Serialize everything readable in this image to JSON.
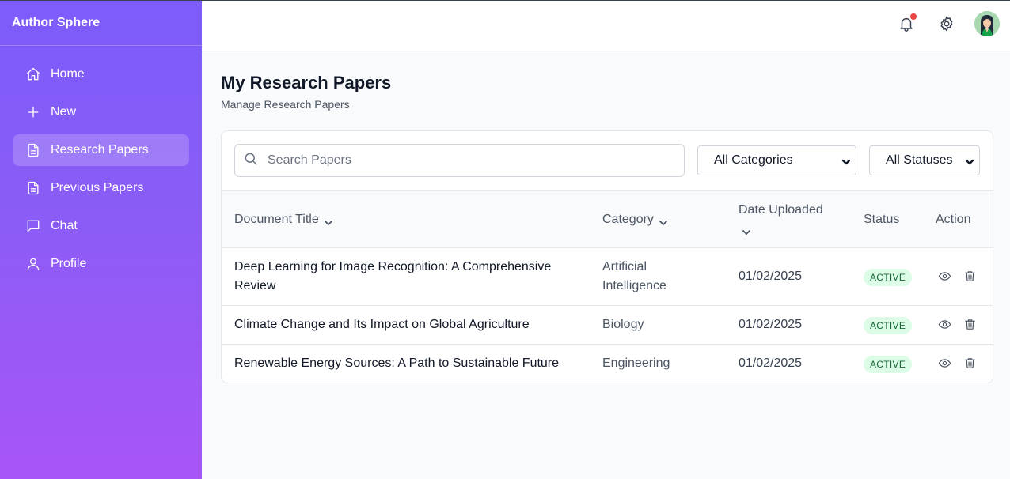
{
  "app": {
    "name": "Author Sphere"
  },
  "sidebar": {
    "items": [
      {
        "label": "Home",
        "icon": "home-icon",
        "active": false
      },
      {
        "label": "New",
        "icon": "plus-icon",
        "active": false
      },
      {
        "label": "Research Papers",
        "icon": "document-icon",
        "active": true
      },
      {
        "label": "Previous Papers",
        "icon": "document-icon",
        "active": false
      },
      {
        "label": "Chat",
        "icon": "chat-icon",
        "active": false
      },
      {
        "label": "Profile",
        "icon": "user-icon",
        "active": false
      }
    ]
  },
  "topbar": {
    "icons": [
      "bell-icon",
      "gear-icon",
      "avatar"
    ]
  },
  "page": {
    "title": "My Research Papers",
    "subtitle": "Manage Research Papers"
  },
  "filters": {
    "search_placeholder": "Search Papers",
    "category_selected": "All Categories",
    "status_selected": "All Statuses"
  },
  "table": {
    "headers": {
      "title": "Document Title",
      "category": "Category",
      "date": "Date Uploaded",
      "status": "Status",
      "action": "Action"
    },
    "rows": [
      {
        "title": "Deep Learning for Image Recognition: A Comprehensive Review",
        "category": "Artificial Intelligence",
        "date": "01/02/2025",
        "status": "ACTIVE"
      },
      {
        "title": "Climate Change and Its Impact on Global Agriculture",
        "category": "Biology",
        "date": "01/02/2025",
        "status": "ACTIVE"
      },
      {
        "title": "Renewable Energy Sources: A Path to Sustainable Future",
        "category": "Engineering",
        "date": "01/02/2025",
        "status": "ACTIVE"
      }
    ]
  },
  "colors": {
    "sidebar_top": "#7c5cfb",
    "sidebar_bottom": "#a855f7",
    "badge_bg": "#dcfce7",
    "badge_text": "#166534",
    "notification_dot": "#ef4444"
  }
}
